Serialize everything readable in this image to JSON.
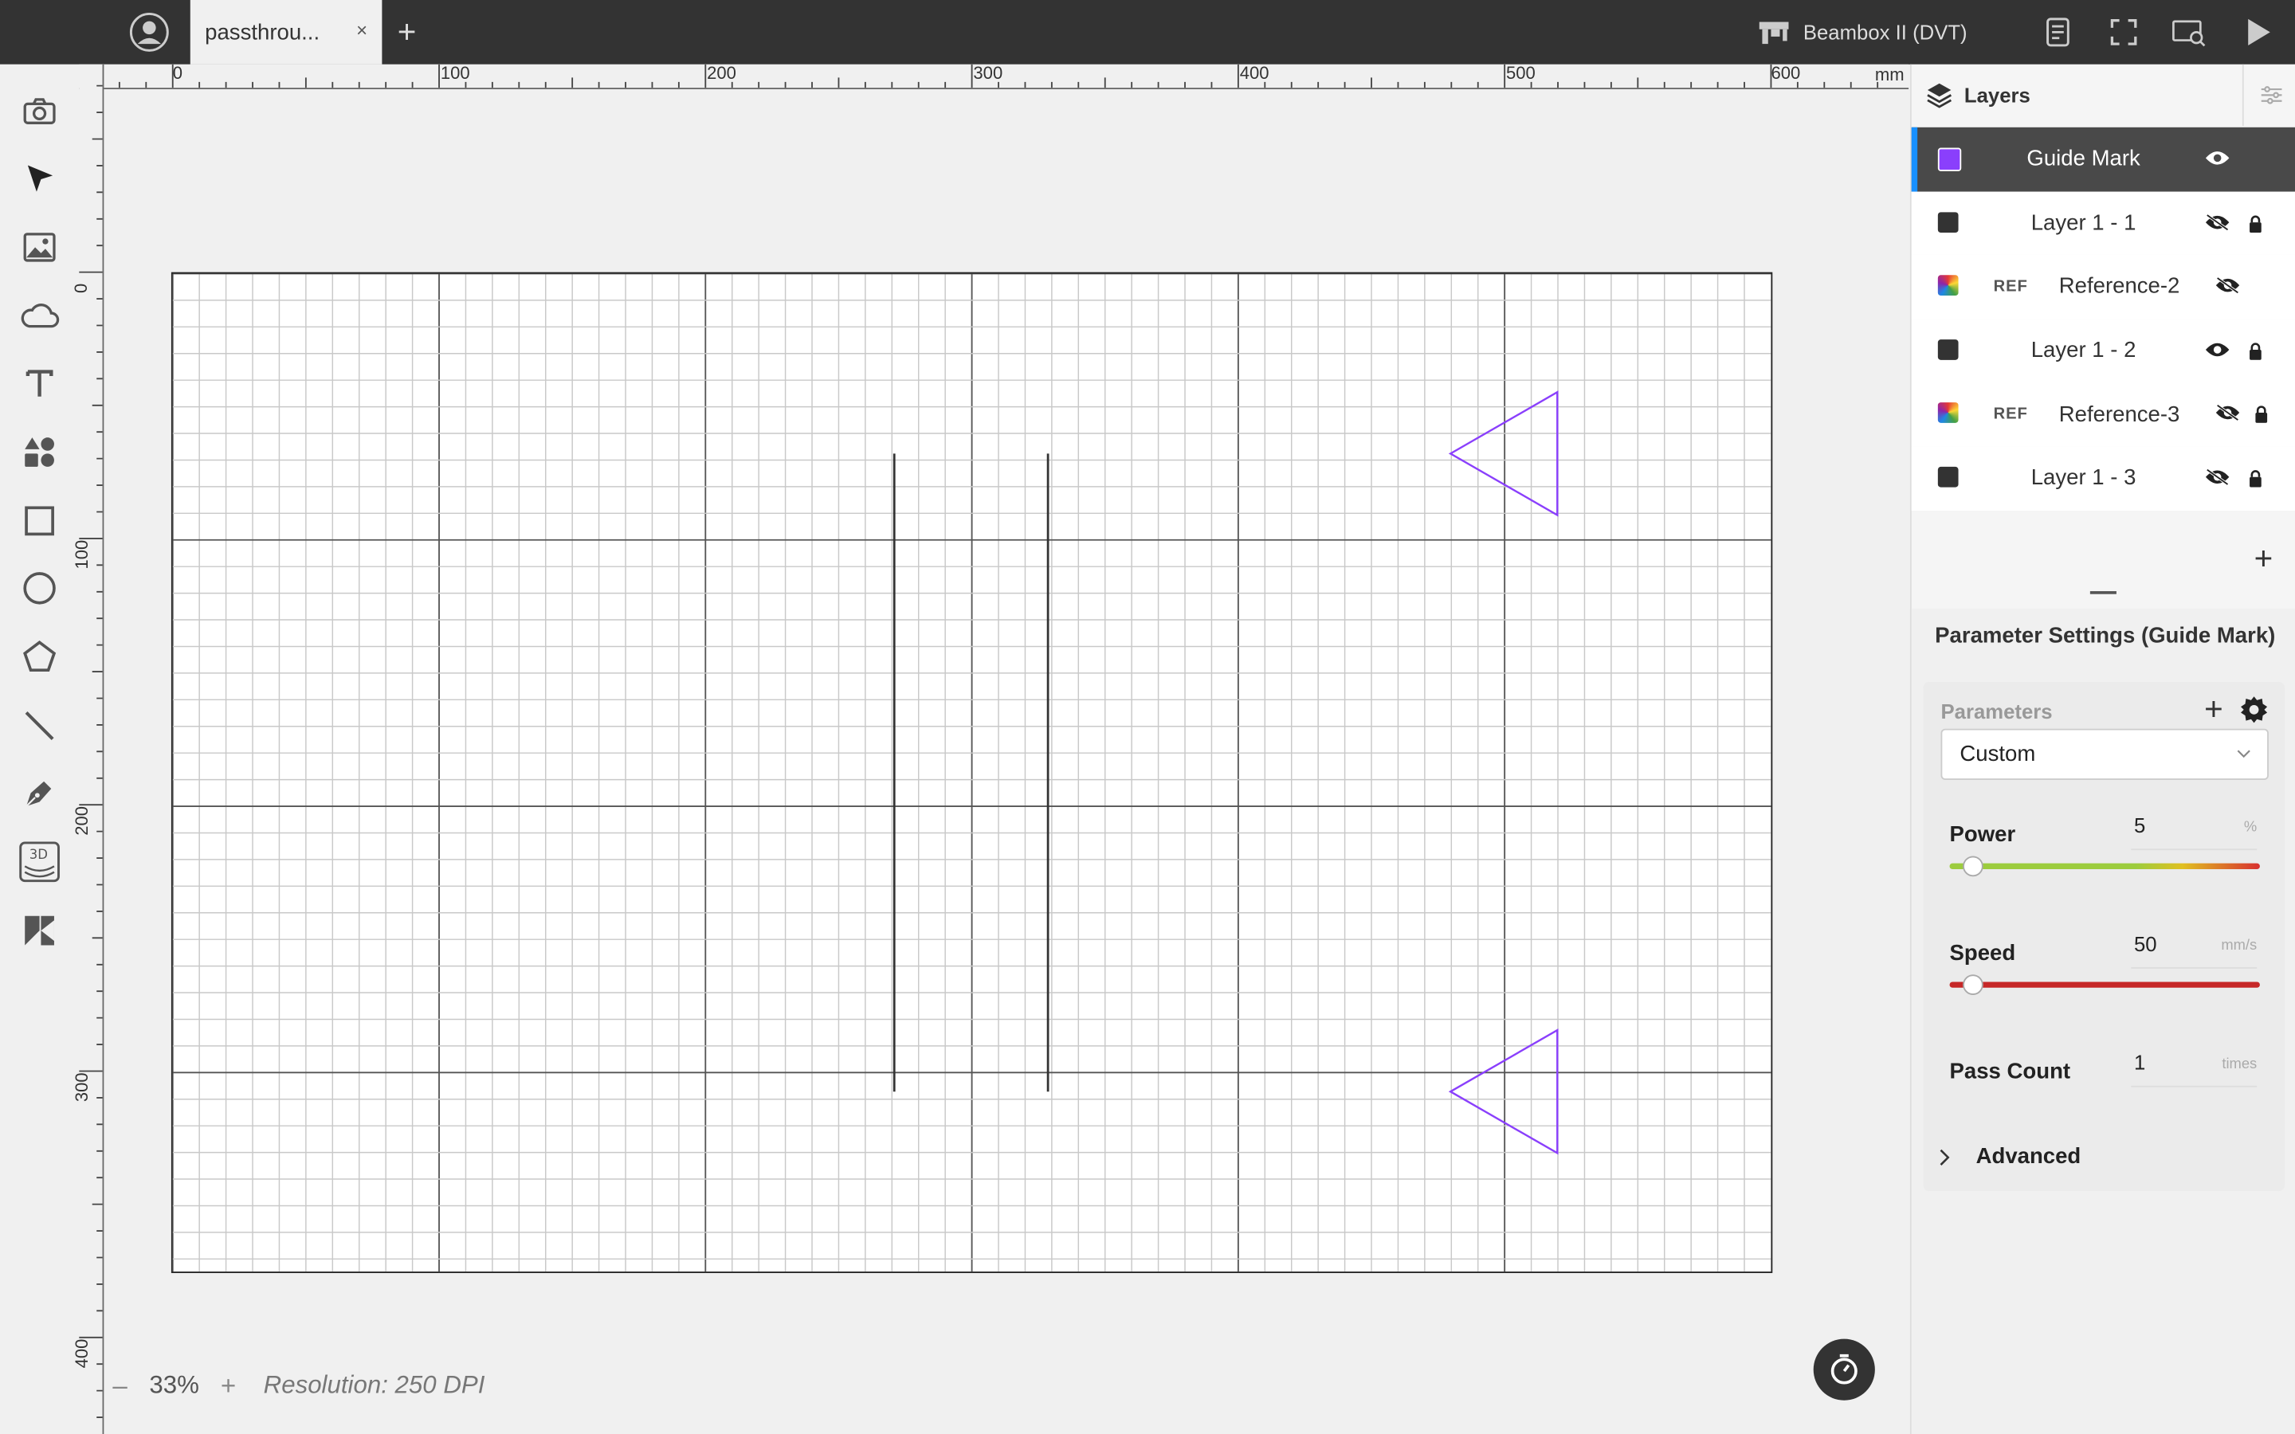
{
  "topbar": {
    "tab_label": "passthrou...",
    "tab_close": "×",
    "new_tab": "+",
    "machine_name": "Beambox II (DVT)"
  },
  "left_toolbar": {
    "tools": [
      "camera-icon",
      "select-arrow-icon",
      "image-icon",
      "cloud-icon",
      "text-icon",
      "shapes-icon",
      "rectangle-icon",
      "ellipse-icon",
      "polygon-icon",
      "line-icon",
      "pen-icon",
      "3d-curve-icon",
      "dxf-icon"
    ]
  },
  "rulers": {
    "top_labels": [
      "0",
      "100",
      "200",
      "300",
      "400",
      "500",
      "600"
    ],
    "left_labels": [
      "0",
      "100",
      "200",
      "300",
      "400"
    ],
    "unit": "mm"
  },
  "canvas": {
    "guide_color": "#8a3ffc",
    "line_color": "#333333"
  },
  "bottom": {
    "zoom_minus": "–",
    "zoom_value": "33%",
    "zoom_plus": "+",
    "resolution": "Resolution: 250 DPI"
  },
  "layers": {
    "title": "Layers",
    "add": "+",
    "items": [
      {
        "name": "Guide Mark",
        "ref": "",
        "color": "#8a3ffc",
        "visible": true,
        "locked": false,
        "selected": true
      },
      {
        "name": "Layer 1 - 1",
        "ref": "",
        "color": "#333333",
        "visible": false,
        "locked": true,
        "selected": false
      },
      {
        "name": "Reference-2",
        "ref": "REF",
        "color": "multicolor",
        "visible": false,
        "locked": false,
        "selected": false
      },
      {
        "name": "Layer 1 - 2",
        "ref": "",
        "color": "#333333",
        "visible": true,
        "locked": true,
        "selected": false
      },
      {
        "name": "Reference-3",
        "ref": "REF",
        "color": "multicolor",
        "visible": false,
        "locked": true,
        "selected": false
      },
      {
        "name": "Layer 1 - 3",
        "ref": "",
        "color": "#333333",
        "visible": false,
        "locked": true,
        "selected": false
      }
    ]
  },
  "params": {
    "title": "Parameter Settings (Guide Mark)",
    "parameters_label": "Parameters",
    "parameters_add": "+",
    "preset": "Custom",
    "power_label": "Power",
    "power_value": "5",
    "power_unit": "%",
    "power_level": 0.05,
    "speed_label": "Speed",
    "speed_value": "50",
    "speed_unit": "mm/s",
    "speed_level": 0.05,
    "pass_label": "Pass Count",
    "pass_value": "1",
    "pass_unit": "times",
    "advanced_label": "Advanced"
  }
}
